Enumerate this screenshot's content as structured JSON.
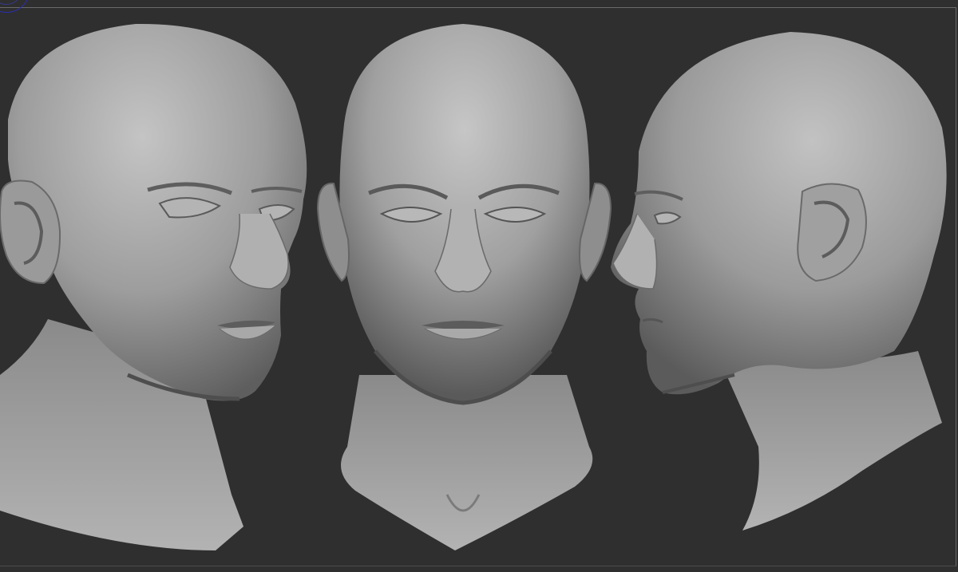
{
  "viewport": {
    "background": "#2f2f2f",
    "clay_color": "#9a9a9a",
    "border_color": "#6a6a6a"
  },
  "gizmo": {
    "color": "#2b2fb0",
    "icon": "navigation-gizmo-icon"
  },
  "sculpt_views": [
    {
      "view": "three-quarter",
      "facing": "right"
    },
    {
      "view": "front",
      "facing": "viewer"
    },
    {
      "view": "profile",
      "facing": "left"
    }
  ]
}
